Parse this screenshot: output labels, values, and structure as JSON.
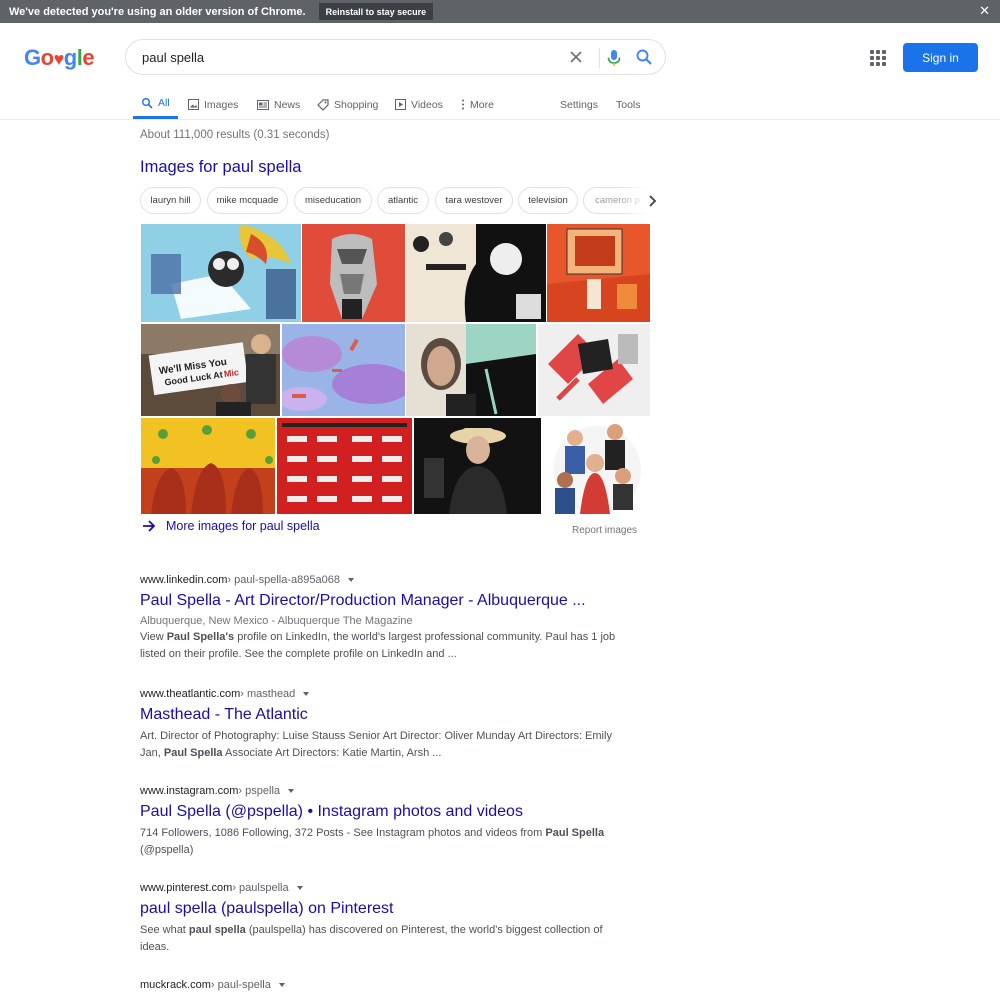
{
  "banner": {
    "message": "We've detected you're using an older version of Chrome.",
    "button_label": "Reinstall to stay secure",
    "close_glyph": "✕"
  },
  "logo": {
    "letters": [
      "G",
      "o",
      "♥",
      "g",
      "l",
      "e"
    ],
    "colors": {
      "blue": "#4285f4",
      "red": "#ea4335",
      "green": "#34a853"
    }
  },
  "search": {
    "query": "paul spella",
    "icons": [
      "close-icon",
      "mic-icon",
      "search-icon"
    ]
  },
  "header": {
    "signin_label": "Sign in",
    "apps_icon": "apps-grid-icon",
    "accent_color": "#1a73e8"
  },
  "tabs": [
    {
      "label": "All",
      "icon": "search-icon",
      "active": true
    },
    {
      "label": "Images",
      "icon": "image-icon",
      "active": false
    },
    {
      "label": "News",
      "icon": "news-icon",
      "active": false
    },
    {
      "label": "Shopping",
      "icon": "tag-icon",
      "active": false
    },
    {
      "label": "Videos",
      "icon": "play-icon",
      "active": false
    },
    {
      "label": "More",
      "icon": "more-vert-icon",
      "active": false
    }
  ],
  "tools": [
    "Settings",
    "Tools"
  ],
  "stats": "About 111,000 results (0.31 seconds)",
  "images_section": {
    "heading": "Images for paul spella",
    "chips": [
      "lauryn hill",
      "mike mcquade",
      "miseducation",
      "atlantic",
      "tara westover",
      "television",
      "cameron p"
    ],
    "more_label": "More images for paul spella",
    "report_label": "Report images"
  },
  "results": [
    {
      "domain": "www.linkedin.com",
      "path": " › paul-spella-a895a068",
      "title": "Paul Spella - Art Director/Production Manager - Albuquerque ...",
      "meta": "Albuquerque, New Mexico - Albuquerque The Magazine",
      "snippet_parts": [
        "View ",
        "Paul Spella's",
        " profile on LinkedIn, the world's largest professional community. Paul has 1 job listed on their profile. See the complete profile on LinkedIn and ..."
      ]
    },
    {
      "domain": "www.theatlantic.com",
      "path": " › masthead",
      "title": "Masthead - The Atlantic",
      "snippet_parts": [
        "Art. Director of Photography: Luise Stauss Senior Art Director: Oliver Munday Art Directors: Emily Jan, ",
        "Paul Spella",
        " Associate Art Directors: Katie Martin, Arsh ..."
      ]
    },
    {
      "domain": "www.instagram.com",
      "path": " › pspella",
      "title": "Paul Spella (@pspella) • Instagram photos and videos",
      "snippet_parts": [
        "714 Followers, 1086 Following, 372 Posts - See Instagram photos and videos from ",
        "Paul Spella",
        " (@pspella)"
      ]
    },
    {
      "domain": "www.pinterest.com",
      "path": " › paulspella",
      "title": "paul spella (paulspella) on Pinterest",
      "snippet_parts": [
        "See what ",
        "paul spella",
        " (paulspella) has discovered on Pinterest, the world's biggest collection of ideas."
      ]
    },
    {
      "domain": "muckrack.com",
      "path": " › paul-spella"
    }
  ],
  "link_color": "#1a0dab"
}
